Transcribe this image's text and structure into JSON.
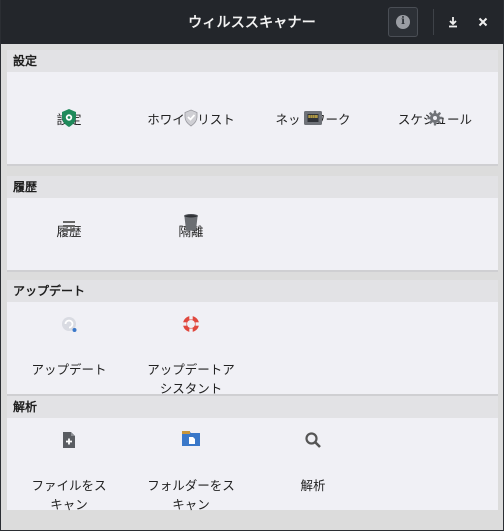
{
  "window": {
    "title": "ウィルススキャナー",
    "info_icon": "i",
    "download_icon": "⤓",
    "close_icon": "✕"
  },
  "sections": [
    {
      "title": "設定",
      "items": [
        {
          "label": "設定",
          "icon": "shield-settings-icon"
        },
        {
          "label": "ホワイトリスト",
          "icon": "whitelist-shield-icon"
        },
        {
          "label": "ネットワーク",
          "icon": "network-icon"
        },
        {
          "label": "スケジュール",
          "icon": "gear-icon"
        }
      ]
    },
    {
      "title": "履歴",
      "items": [
        {
          "label": "履歴",
          "icon": "list-icon"
        },
        {
          "label": "隔離",
          "icon": "trash-icon"
        }
      ]
    },
    {
      "title": "アップデート",
      "items": [
        {
          "label": "アップデート",
          "icon": "update-icon"
        },
        {
          "label": "アップデートア\nシスタント",
          "icon": "lifebuoy-icon"
        }
      ]
    },
    {
      "title": "解析",
      "items": [
        {
          "label": "ファイルをス\nキャン",
          "icon": "add-file-icon"
        },
        {
          "label": "フォルダーをス\nキャン",
          "icon": "folder-icon"
        },
        {
          "label": "解析",
          "icon": "search-icon"
        }
      ]
    }
  ],
  "colors": {
    "titlebar": "#23262b",
    "section_bg": "#f0f0f5",
    "header_bg": "#e2e2e5",
    "green": "#1f8a5b",
    "blue": "#3a78c9",
    "red": "#e0483e"
  }
}
